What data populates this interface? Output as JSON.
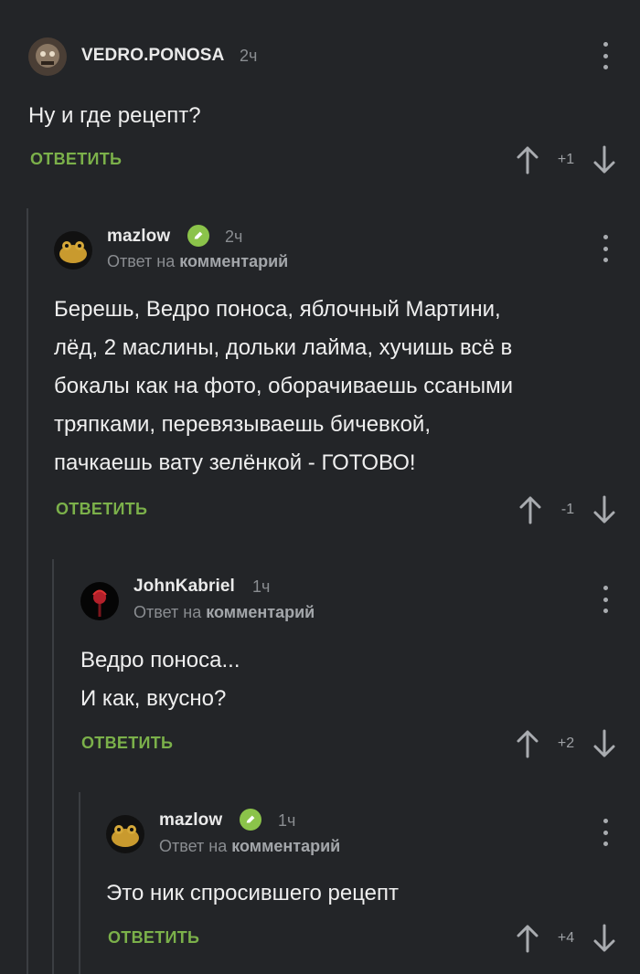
{
  "comments": [
    {
      "username": "VEDRO.PONOSA",
      "time": "2ч",
      "reply_to_prefix": "",
      "reply_to_target": "",
      "text_lines": [
        "Ну и где рецепт?"
      ],
      "reply_label": "ОТВЕТИТЬ",
      "score": "+1",
      "verified": false
    },
    {
      "username": "mazlow",
      "time": "2ч",
      "reply_to_prefix": "Ответ на",
      "reply_to_target": "комментарий",
      "text_lines": [
        "Берешь, Ведро поноса, яблочный Мартини,",
        "лёд, 2 маслины, дольки лайма, хучишь всё в",
        "бокалы как на фото, оборачиваешь ссаными",
        "тряпками, перевязываешь бичевкой,",
        "пачкаешь вату зелёнкой - ГОТОВО!"
      ],
      "reply_label": "ОТВЕТИТЬ",
      "score": "-1",
      "verified": true
    },
    {
      "username": "JohnKabriel",
      "time": "1ч",
      "reply_to_prefix": "Ответ на",
      "reply_to_target": "комментарий",
      "text_lines": [
        "Ведро поноса...",
        "И как, вкусно?"
      ],
      "reply_label": "ОТВЕТИТЬ",
      "score": "+2",
      "verified": false
    },
    {
      "username": "mazlow",
      "time": "1ч",
      "reply_to_prefix": "Ответ на",
      "reply_to_target": "комментарий",
      "text_lines": [
        "Это ник спросившего рецепт"
      ],
      "reply_label": "ОТВЕТИТЬ",
      "score": "+4",
      "verified": true
    }
  ],
  "colors": {
    "background": "#232528",
    "accent_green": "#7bb04a",
    "verified_badge": "#8bc34a",
    "muted_text": "#8a8d91"
  },
  "icons": {
    "menu": "kebab-menu-icon",
    "upvote": "arrow-up-icon",
    "downvote": "arrow-down-icon",
    "verified": "pencil-check-icon"
  }
}
